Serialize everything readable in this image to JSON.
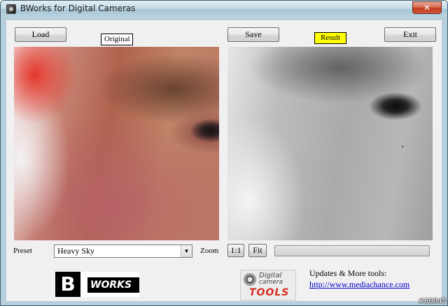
{
  "window": {
    "title": "BWorks for Digital Cameras",
    "close_glyph": "✕"
  },
  "toolbar": {
    "load_label": "Load",
    "save_label": "Save",
    "exit_label": "Exit"
  },
  "panels": {
    "original_label": "Original",
    "result_label": "Result",
    "original_label_bg": "#ffffff",
    "result_label_bg": "#ffff00"
  },
  "controls": {
    "preset_label": "Preset",
    "preset_value": "Heavy Sky",
    "zoom_label": "Zoom",
    "zoom_1to1_label": "1:1",
    "zoom_fit_label": "Fit",
    "progress_fraction": 0
  },
  "logos": {
    "bworks_b": "B",
    "bworks_word": "WORKS",
    "dct_line1": "Digital",
    "dct_line2": "camera",
    "dct_tools": "TOOLS"
  },
  "footer": {
    "updates_text": "Updates & More tools:",
    "link_text": "http://www.mediachance.com"
  },
  "watermark": "#60845",
  "colors": {
    "title_close": "#c2391d",
    "tools_red": "#d82b1f",
    "link_blue": "#0000cc"
  }
}
